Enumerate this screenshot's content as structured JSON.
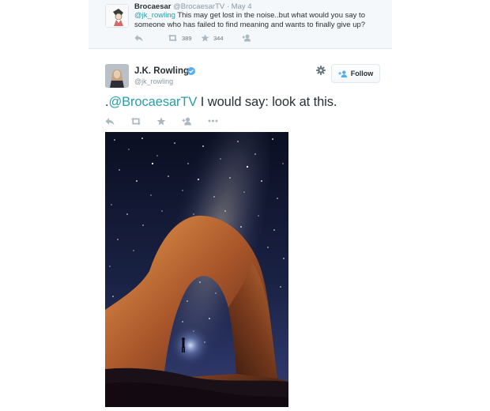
{
  "reply_tweet": {
    "name": "Brocaesar",
    "handle": "@BrocaesarTV",
    "separator": "·",
    "date": "May 4",
    "mention": "@jk_rowling",
    "text": " This may get lost in the noise..but what would you say to someone who has failed to find meaning and wants to finally give up?",
    "retweet_count": "389",
    "favorite_count": "344"
  },
  "main_tweet": {
    "name": "J.K. Rowling",
    "handle": "@jk_rowling",
    "follow_label": "Follow",
    "text_prefix": ".",
    "mention": "@BrocaesarTV",
    "text": " I would say: look at this."
  },
  "icons": [
    "reply-icon",
    "retweet-icon",
    "favorite-icon",
    "follow-icon",
    "more-icon",
    "gear-icon",
    "verified-icon"
  ],
  "colors": {
    "link": "#2b9ba9",
    "verified": "#55acee",
    "muted": "#8899a6",
    "action": "#aab8c2"
  }
}
